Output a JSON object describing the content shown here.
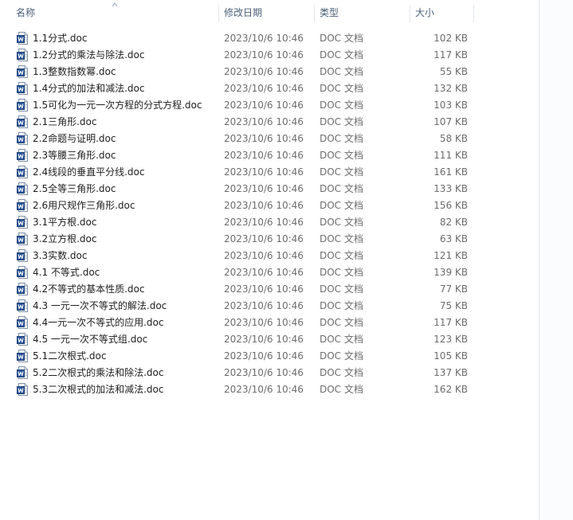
{
  "header": {
    "col_name": "名称",
    "col_date": "修改日期",
    "col_type": "类型",
    "col_size": "大小"
  },
  "files": [
    {
      "name": "1.1分式.doc",
      "date": "2023/10/6 10:46",
      "type": "DOC 文档",
      "size": "102 KB"
    },
    {
      "name": "1.2分式的乘法与除法.doc",
      "date": "2023/10/6 10:46",
      "type": "DOC 文档",
      "size": "117 KB"
    },
    {
      "name": "1.3整数指数幂.doc",
      "date": "2023/10/6 10:46",
      "type": "DOC 文档",
      "size": "55 KB"
    },
    {
      "name": "1.4分式的加法和减法.doc",
      "date": "2023/10/6 10:46",
      "type": "DOC 文档",
      "size": "132 KB"
    },
    {
      "name": "1.5可化为一元一次方程的分式方程.doc",
      "date": "2023/10/6 10:46",
      "type": "DOC 文档",
      "size": "103 KB"
    },
    {
      "name": "2.1三角形.doc",
      "date": "2023/10/6 10:46",
      "type": "DOC 文档",
      "size": "107 KB"
    },
    {
      "name": "2.2命题与证明.doc",
      "date": "2023/10/6 10:46",
      "type": "DOC 文档",
      "size": "58 KB"
    },
    {
      "name": "2.3等腰三角形.doc",
      "date": "2023/10/6 10:46",
      "type": "DOC 文档",
      "size": "111 KB"
    },
    {
      "name": "2.4线段的垂直平分线.doc",
      "date": "2023/10/6 10:46",
      "type": "DOC 文档",
      "size": "161 KB"
    },
    {
      "name": "2.5全等三角形.doc",
      "date": "2023/10/6 10:46",
      "type": "DOC 文档",
      "size": "133 KB"
    },
    {
      "name": "2.6用尺规作三角形.doc",
      "date": "2023/10/6 10:46",
      "type": "DOC 文档",
      "size": "156 KB"
    },
    {
      "name": "3.1平方根.doc",
      "date": "2023/10/6 10:46",
      "type": "DOC 文档",
      "size": "82 KB"
    },
    {
      "name": "3.2立方根.doc",
      "date": "2023/10/6 10:46",
      "type": "DOC 文档",
      "size": "63 KB"
    },
    {
      "name": "3.3实数.doc",
      "date": "2023/10/6 10:46",
      "type": "DOC 文档",
      "size": "121 KB"
    },
    {
      "name": "4.1 不等式.doc",
      "date": "2023/10/6 10:46",
      "type": "DOC 文档",
      "size": "139 KB"
    },
    {
      "name": "4.2不等式的基本性质.doc",
      "date": "2023/10/6 10:46",
      "type": "DOC 文档",
      "size": "77 KB"
    },
    {
      "name": "4.3 一元一次不等式的解法.doc",
      "date": "2023/10/6 10:46",
      "type": "DOC 文档",
      "size": "75 KB"
    },
    {
      "name": "4.4一元一次不等式的应用.doc",
      "date": "2023/10/6 10:46",
      "type": "DOC 文档",
      "size": "117 KB"
    },
    {
      "name": "4.5 一元一次不等式组.doc",
      "date": "2023/10/6 10:46",
      "type": "DOC 文档",
      "size": "123 KB"
    },
    {
      "name": "5.1二次根式.doc",
      "date": "2023/10/6 10:46",
      "type": "DOC 文档",
      "size": "105 KB"
    },
    {
      "name": "5.2二次根式的乘法和除法.doc",
      "date": "2023/10/6 10:46",
      "type": "DOC 文档",
      "size": "137 KB"
    },
    {
      "name": "5.3二次根式的加法和减法.doc",
      "date": "2023/10/6 10:46",
      "type": "DOC 文档",
      "size": "162 KB"
    }
  ],
  "icon": "word-document-icon",
  "colors": {
    "header_text": "#4c607a",
    "name_text": "#1e1e1e",
    "meta_text": "#6d6d6d",
    "icon_blue": "#2b579a"
  }
}
